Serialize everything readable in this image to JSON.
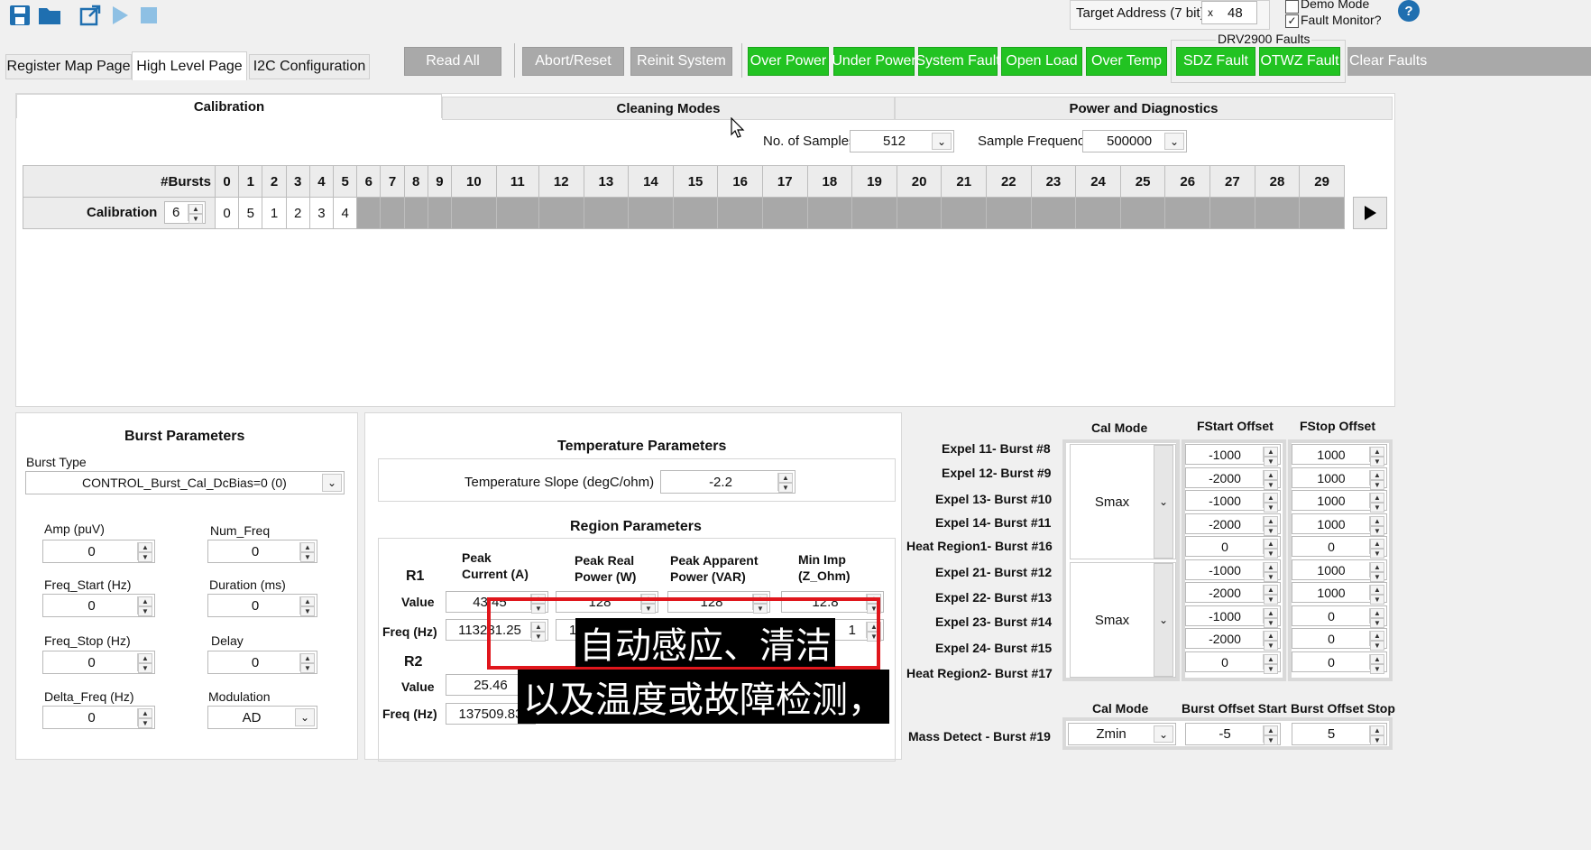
{
  "toolbar": {
    "icons": [
      "save-icon",
      "folder-icon",
      "external-link-icon",
      "play-icon",
      "stop-icon"
    ]
  },
  "target": {
    "label": "Target Address (7 bit)",
    "prefix": "x",
    "value": "48",
    "demo_mode": "Demo Mode",
    "fault_monitor": "Fault Monitor?",
    "help": "?"
  },
  "tabs": [
    "Register Map Page",
    "High Level Page",
    "I2C Configuration"
  ],
  "buttons": {
    "read_all": "Read All",
    "abort": "Abort/Reset",
    "reinit": "Reinit System"
  },
  "faults": {
    "main": [
      "Over Power",
      "Under Power",
      "System Fault",
      "Open Load",
      "Over Temp"
    ],
    "drv_title": "DRV2900 Faults",
    "drv": [
      "SDZ Fault",
      "OTWZ Fault"
    ],
    "clear": "Clear Faults"
  },
  "subtabs": [
    "Calibration",
    "Cleaning Modes",
    "Power and Diagnostics"
  ],
  "sampling": {
    "samples_label": "No. of Samples",
    "samples_value": "512",
    "freq_label": "Sample Frequency",
    "freq_value": "500000"
  },
  "bursts": {
    "header_label": "#Bursts",
    "indices": [
      "0",
      "1",
      "2",
      "3",
      "4",
      "5",
      "6",
      "7",
      "8",
      "9",
      "10",
      "11",
      "12",
      "13",
      "14",
      "15",
      "16",
      "17",
      "18",
      "19",
      "20",
      "21",
      "22",
      "23",
      "24",
      "25",
      "26",
      "27",
      "28",
      "29"
    ],
    "row_label": "Calibration",
    "count": "6",
    "values": [
      "0",
      "5",
      "1",
      "2",
      "3",
      "4"
    ]
  },
  "burst_params": {
    "title": "Burst Parameters",
    "type_label": "Burst Type",
    "type_value": "CONTROL_Burst_Cal_DcBias=0 (0)",
    "amp_label": "Amp (puV)",
    "amp": "0",
    "numfreq_label": "Num_Freq",
    "numfreq": "0",
    "fstart_label": "Freq_Start (Hz)",
    "fstart": "0",
    "duration_label": "Duration (ms)",
    "duration": "0",
    "fstop_label": "Freq_Stop (Hz)",
    "fstop": "0",
    "delay_label": "Delay",
    "delay": "0",
    "dfreq_label": "Delta_Freq (Hz)",
    "dfreq": "0",
    "mod_label": "Modulation",
    "mod": "AD"
  },
  "temp": {
    "title": "Temperature Parameters",
    "slope_label": "Temperature Slope (degC/ohm)",
    "slope": "-2.2"
  },
  "region": {
    "title": "Region Parameters",
    "r1": "R1",
    "r2": "R2",
    "value_label": "Value",
    "freq_label": "Freq (Hz)",
    "col1": "Peak\nCurrent (A)",
    "col2": "Peak Real\nPower (W)",
    "col3": "Peak Apparent\nPower (VAR)",
    "col4": "Min Imp\n(Z_Ohm)",
    "r1_value": [
      "43.45",
      "128",
      "128",
      "12.8"
    ],
    "r1_freq": [
      "113281.25",
      "1",
      "",
      "1"
    ],
    "r2_value": "25.46",
    "r2_freq": "137509.83"
  },
  "calmode": {
    "header_mode": "Cal Mode",
    "header_start": "FStart Offset",
    "header_stop": "FStop Offset",
    "rows": [
      {
        "label": "Expel 11- Burst #8",
        "start": "-1000",
        "stop": "1000"
      },
      {
        "label": "Expel 12- Burst #9",
        "start": "-2000",
        "stop": "1000"
      },
      {
        "label": "Expel 13- Burst #10",
        "start": "-1000",
        "stop": "1000"
      },
      {
        "label": "Expel 14- Burst #11",
        "start": "-2000",
        "stop": "1000"
      },
      {
        "label": "Heat Region1- Burst #16",
        "start": "0",
        "stop": "0"
      },
      {
        "label": "Expel 21- Burst #12",
        "start": "-1000",
        "stop": "1000"
      },
      {
        "label": "Expel 22- Burst #13",
        "start": "-2000",
        "stop": "1000"
      },
      {
        "label": "Expel 23- Burst #14",
        "start": "-1000",
        "stop": "0"
      },
      {
        "label": "Expel 24- Burst #15",
        "start": "-2000",
        "stop": "0"
      },
      {
        "label": "Heat Region2- Burst #17",
        "start": "0",
        "stop": "0"
      }
    ],
    "mode1": "Smax",
    "mode2": "Smax",
    "mass_header_mode": "Cal Mode",
    "mass_header_start": "Burst Offset Start",
    "mass_header_stop": "Burst Offset Stop",
    "mass_label": "Mass Detect - Burst #19",
    "mass_mode": "Zmin",
    "mass_start": "-5",
    "mass_stop": "5"
  },
  "subtitles": {
    "line1": "自动感应、清洁",
    "line2": "以及温度或故障检测，"
  },
  "colors": {
    "fault_green": "#22c322",
    "button_gray": "#a9a9a9",
    "highlight_red": "#e0161c"
  }
}
